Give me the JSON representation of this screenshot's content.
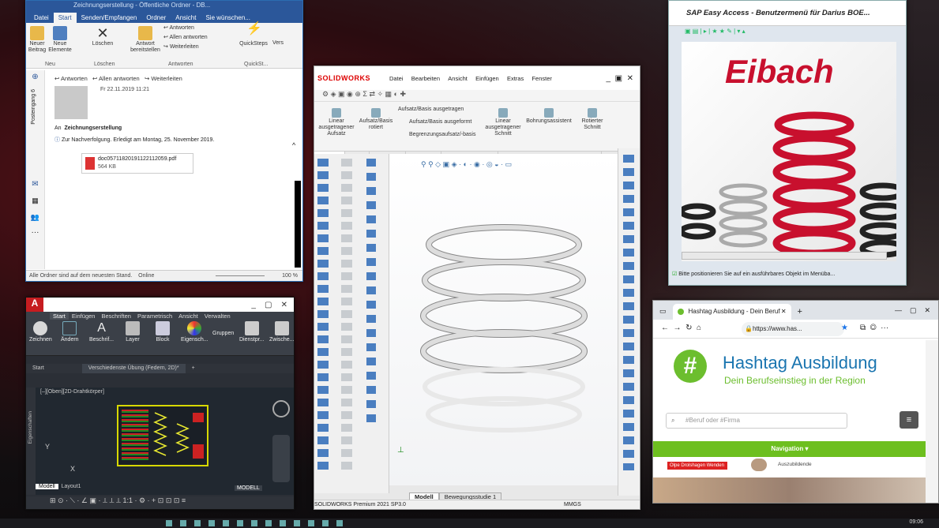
{
  "outlook": {
    "title": "Zeichnungserstellung - Öffentliche Ordner - DB...",
    "tabs": [
      "Datei",
      "Start",
      "Senden/Empfangen",
      "Ordner",
      "Ansicht",
      "Sie wünschen..."
    ],
    "ribbon": {
      "new_mail": "Neuer Beitrag",
      "new_items": "Neue Elemente",
      "delete": "Löschen",
      "reply_post": "Antwort bereitstellen",
      "reply": "Antworten",
      "reply_all": "Allen antworten",
      "forward": "Weiterleiten",
      "quicksteps": "QuickSteps",
      "move": "Vers",
      "groups": [
        "Neu",
        "Löschen",
        "Antworten",
        "QuickSt..."
      ]
    },
    "reading": {
      "reply": "Antworten",
      "reply_all": "Allen antworten",
      "forward": "Weiterleiten",
      "date": "Fr 22.11.2019 11:21",
      "to_label": "An",
      "to_value": "Zeichnungserstellung",
      "followup": "Zur Nachverfolgung.  Erledigt am Montag, 25. November 2019.",
      "attachment_name": "doc05711820191122112059.pdf",
      "attachment_size": "564 KB",
      "vertical_label": "Posteingang 6"
    },
    "status": {
      "left": "Alle Ordner sind auf dem neuesten Stand.",
      "online": "Online",
      "zoom": "100 %"
    }
  },
  "sap": {
    "title": "SAP Easy Access  -  Benutzermenü für Darius BOE...",
    "logo_text": "Eibach",
    "status_message": "Bitte positionieren Sie auf ein ausführbares Objekt im Menüba..."
  },
  "solidworks": {
    "logo": "SOLIDWORKS",
    "menu": [
      "Datei",
      "Bearbeiten",
      "Ansicht",
      "Einfügen",
      "Extras",
      "Fenster"
    ],
    "commands": {
      "linear_boss": "Linear ausgetragener Aufsatz",
      "revolved_boss": "Aufsatz/Basis rotiert",
      "swept_boss": "Aufsatz/Basis ausgetragen",
      "lofted_boss": "Aufsatz/Basis ausgeformt",
      "boundary_boss": "Begrenzungsaufsatz/-basis",
      "linear_cut": "Linear ausgetragener Schnitt",
      "hole_wizard": "Bohrungsassistent",
      "revolved_cut": "Rotierter Schnitt"
    },
    "cm_tabs": [
      "Features",
      "Skizze",
      "Markierung",
      "Evaluieren",
      "MBD-Dimensionen",
      "SOLIDWORKS Zusatzanwendungen"
    ],
    "bottom_tabs": [
      "Modell",
      "Bewegungsstudie 1"
    ],
    "status_left": "SOLIDWORKS Premium 2021 SP3.0",
    "units": "MMGS"
  },
  "autocad": {
    "tabs": [
      "Start",
      "Einfügen",
      "Beschriften",
      "Parametrisch",
      "Ansicht",
      "Verwalten"
    ],
    "buttons": [
      "Zeichnen",
      "Ändern",
      "Beschrif...",
      "Layer",
      "Block",
      "Eigensch...",
      "Gruppen",
      "Dienstpr...",
      "Zwische..."
    ],
    "doc_tabs": [
      "Start",
      "Verschiedenste Übung (Federn, 2D)*"
    ],
    "viewport": "[–][Oben][2D-Drahtkörper]",
    "side_label": "Eigenschaften",
    "layout_tabs": [
      "Modell",
      "Layout1"
    ],
    "model_badge": "MODELL"
  },
  "edge": {
    "tab_title": "Hashtag Ausbildung - Dein Beruf",
    "url": "https://www.has...",
    "brand": "Hashtag Ausbildung",
    "tagline": "Dein Berufseinstieg in der Region",
    "search_placeholder": "#Beruf oder #Firma",
    "nav": "Navigation ▾",
    "item1": "Olpe Drolshagen Wenden",
    "item2": "Auszubildende"
  },
  "taskbar": {
    "clock": "09:06"
  },
  "colors": {
    "outlook_blue": "#2b579a",
    "sw_red": "#d00",
    "eibach_red": "#c8102e",
    "hashtag_green": "#6cbe2e",
    "edge_nav_green": "#6dbf1f"
  }
}
